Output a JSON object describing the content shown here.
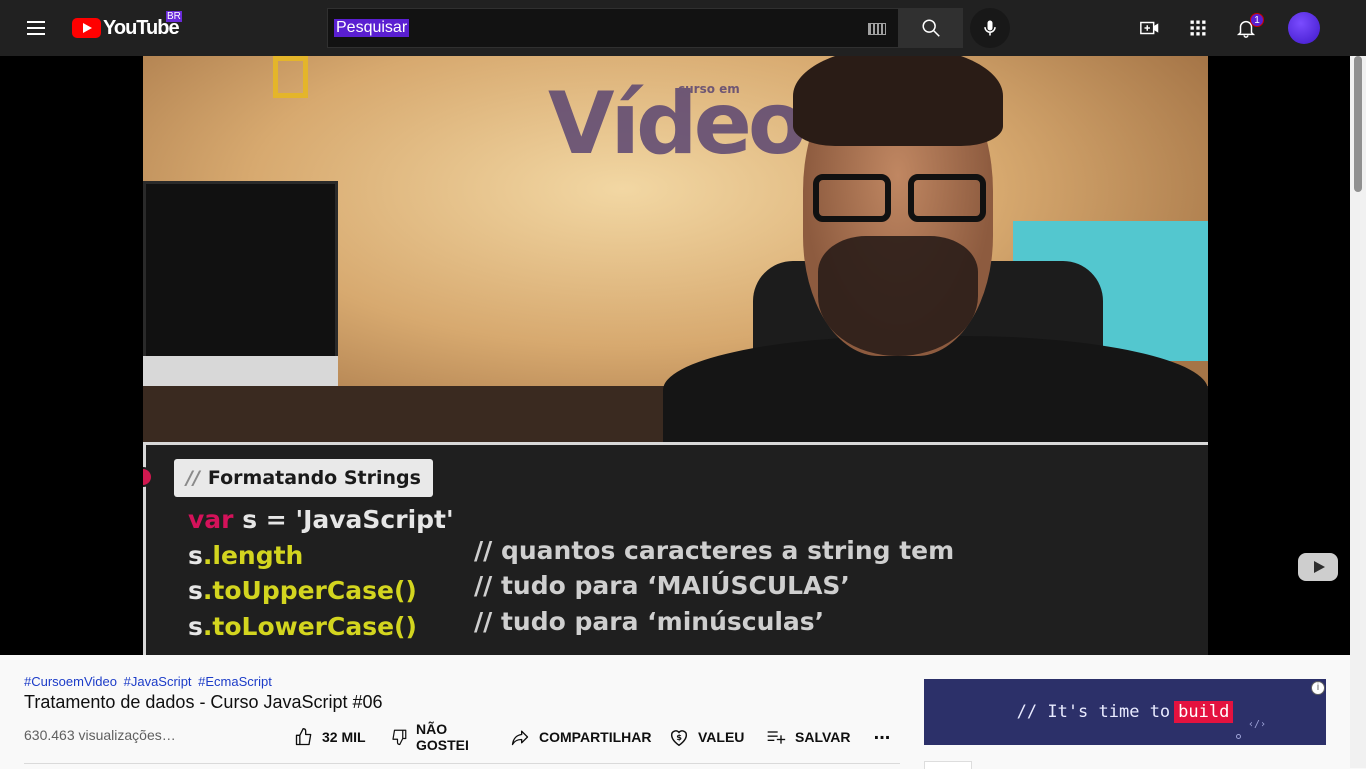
{
  "header": {
    "logo_text": "YouTube",
    "region": "BR",
    "search_placeholder": "Pesquisar",
    "notification_count": "1"
  },
  "video": {
    "code_title_slashes": "//",
    "code_title": "Formatando Strings",
    "code_lines": [
      {
        "obj": "var",
        "rest": " s = 'JavaScript'"
      },
      {
        "obj": "s",
        "method": ".length",
        "comment": "// quantos caracteres a string tem"
      },
      {
        "obj": "s",
        "method": ".toUpperCase()",
        "comment": "// tudo para ‘MAIÚSCULAS’"
      },
      {
        "obj": "s",
        "method": ".toLowerCase()",
        "comment": "// tudo para ‘minúsculas’"
      }
    ],
    "wall_brand": "Vídeo",
    "wall_brand_small": "curso em"
  },
  "info": {
    "hashtags": [
      "#CursoemVideo",
      "#JavaScript",
      "#EcmaScript"
    ],
    "title": "Tratamento de dados - Curso JavaScript #06",
    "views": "630.463 visualizações…",
    "like_count": "32 MIL",
    "dislike_label_1": "NÃO",
    "dislike_label_2": "GOSTEI",
    "share_label": "COMPARTILHAR",
    "thanks_label": "VALEU",
    "save_label": "SALVAR",
    "more_label": "..."
  },
  "ad": {
    "text": "// It's time to",
    "highlight": "build",
    "info_glyph": "i",
    "code_glyph": "‹/›"
  }
}
